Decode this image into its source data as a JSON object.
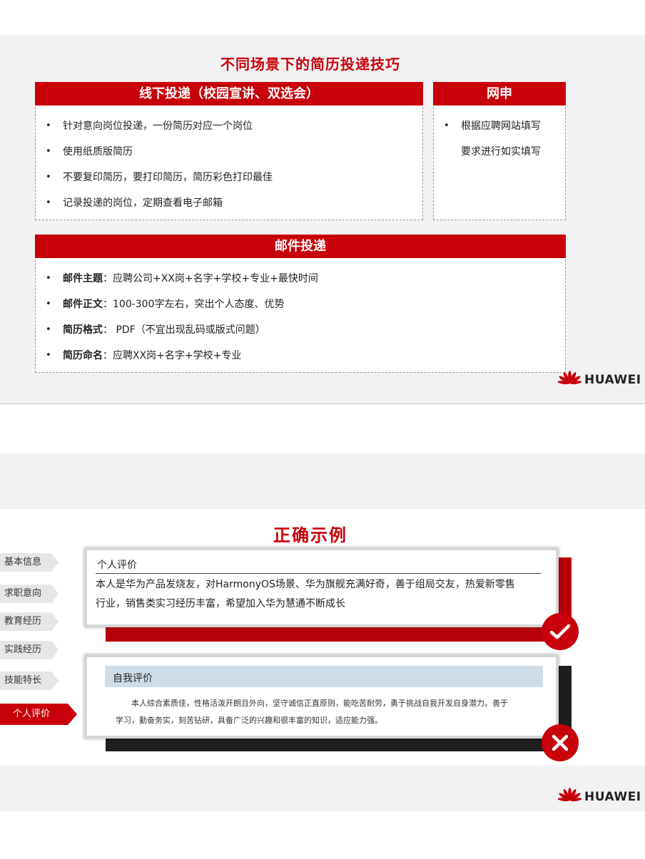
{
  "slide1": {
    "title": "不同场景下的简历投递技巧",
    "offline": {
      "header": "线下投递（校园宣讲、双选会）",
      "items": [
        "针对意向岗位投递，一份简历对应一个岗位",
        "使用纸质版简历",
        "不要复印简历，要打印简历，简历彩色打印最佳",
        "记录投递的岗位，定期查看电子邮箱"
      ]
    },
    "online": {
      "header": "网申",
      "line1": "根据应聘网站填写",
      "line2": "要求进行如实填写"
    },
    "email": {
      "header": "邮件投递",
      "items": [
        {
          "label": "邮件主题",
          "sep": "：",
          "text": "应聘公司+XX岗+名字+学校+专业+最快时间"
        },
        {
          "label": "邮件正文",
          "sep": "：",
          "text": "100-300字左右，突出个人态度、优势"
        },
        {
          "label": "简历格式",
          "sep": "： ",
          "text": "PDF（不宜出现乱码或版式问题）"
        },
        {
          "label": "简历命名",
          "sep": "：",
          "text": "应聘XX岗+名字+学校+专业"
        }
      ]
    },
    "brand": "HUAWEI"
  },
  "slide2": {
    "title": "正确示例",
    "nav": [
      "基本信息",
      "求职意向",
      "教育经历",
      "实践经历",
      "技能特长",
      "个人评价"
    ],
    "good": {
      "heading": "个人评价",
      "body_line1": "本人是华为产品发烧友，对HarmonyOS场景、华为旗舰充满好奇，善于组局交友，热爱新零售",
      "body_line2": "行业，销售类实习经历丰富，希望加入华为慧通不断成长"
    },
    "bad": {
      "heading": "自我评价",
      "body_line1": "本人综合素质佳，性格活泼开朗且外向，坚守诚信正直原则，能吃苦耐劳，勇于挑战自我开发自身潜力。善于",
      "body_line2": "学习，勤奋务实，刻苦钻研，具备广泛的兴趣和很丰富的知识，适应能力强。"
    },
    "brand": "HUAWEI"
  },
  "colors": {
    "accent": "#c8000a",
    "dark": "#1e1e1e",
    "panel_bg": "#f2f2f2"
  },
  "icons": [
    "huawei-logo-icon",
    "check-icon",
    "cross-icon"
  ]
}
